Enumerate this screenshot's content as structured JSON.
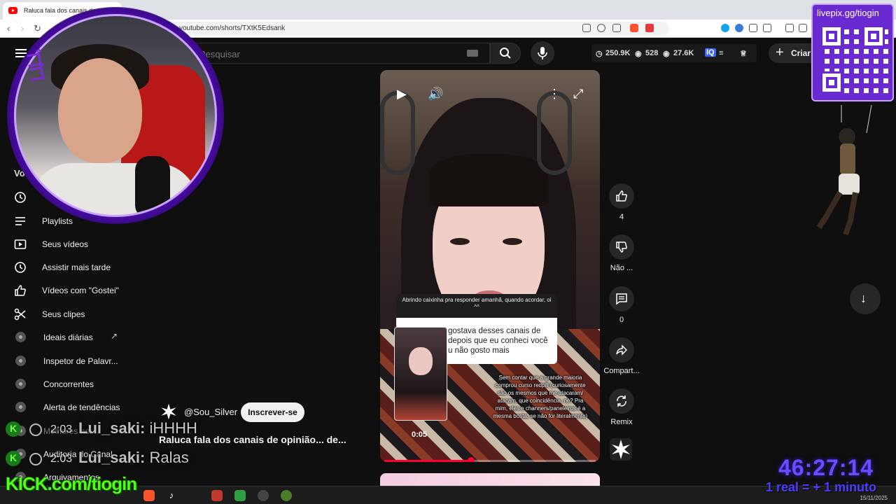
{
  "browser": {
    "tab_title": "Raluca fala dos canais de o...",
    "url": "youtube.com/shorts/TXtK5Edsank"
  },
  "youtube": {
    "search_placeholder": "Pesquisar",
    "create_label": "Criar",
    "stats": {
      "views": "250.9K",
      "viewers": "528",
      "followers": "27.6K"
    }
  },
  "sidebar": {
    "section_label": "Você",
    "items": [
      {
        "label": "Playlists",
        "icon": "playlist-icon"
      },
      {
        "label": "Seus vídeos",
        "icon": "video-icon"
      },
      {
        "label": "Assistir mais tarde",
        "icon": "clock-icon"
      },
      {
        "label": "Vídeos com \"Gostei\"",
        "icon": "like-icon"
      },
      {
        "label": "Seus clipes",
        "icon": "scissors-icon"
      }
    ],
    "tools": [
      {
        "label": "Ideais diárias"
      },
      {
        "label": "Inspetor de Palavr..."
      },
      {
        "label": "Concorrentes"
      },
      {
        "label": "Alerta de tendências"
      },
      {
        "label": "Melhores hor..."
      },
      {
        "label": "Auditoria do Canal"
      },
      {
        "label": "Arquivamentos"
      }
    ]
  },
  "short": {
    "question_header": "Abrindo caixinha pra responder amanhã, quando acordar, oi ^^",
    "question_text": "gostava desses canais de depois que eu conheci você u não gosto mais",
    "overlay_text": "Sem contar que a grande maioria comprou curso redpill (curiosamente são os mesmos que me atacaram/ atacam, que coincidência, né? Pra mim, eles e channers/paneleiros é a mesma bosta, se não for literalmente)",
    "time": "0:05",
    "progress_fraction": 0.41,
    "channel": "@Sou_Silver",
    "subscribe_label": "Inscrever-se",
    "title": "Raluca fala dos canais de opinião... de..."
  },
  "actions": {
    "like_count": "4",
    "dislike_label": "Não ...",
    "comment_count": "0",
    "share_label": "Compart...",
    "remix_label": "Remix"
  },
  "chat": [
    {
      "time": "2:03",
      "user": "Lui_saki:",
      "message": "iHHHH"
    },
    {
      "time": "2:03",
      "user": "Lui_saki:",
      "message": "Ralas"
    }
  ],
  "overlays": {
    "kick": "KICK.com/tiogin",
    "livepix": "livepix.gg/tiogin",
    "timer": "46:27:14",
    "timer_sub": "1 real = + 1 minuto",
    "date": "15/11/2025"
  },
  "colors": {
    "accent_red": "#ff0033",
    "kick_green": "#53fc18",
    "livepix_purple": "#6a2ad1"
  }
}
